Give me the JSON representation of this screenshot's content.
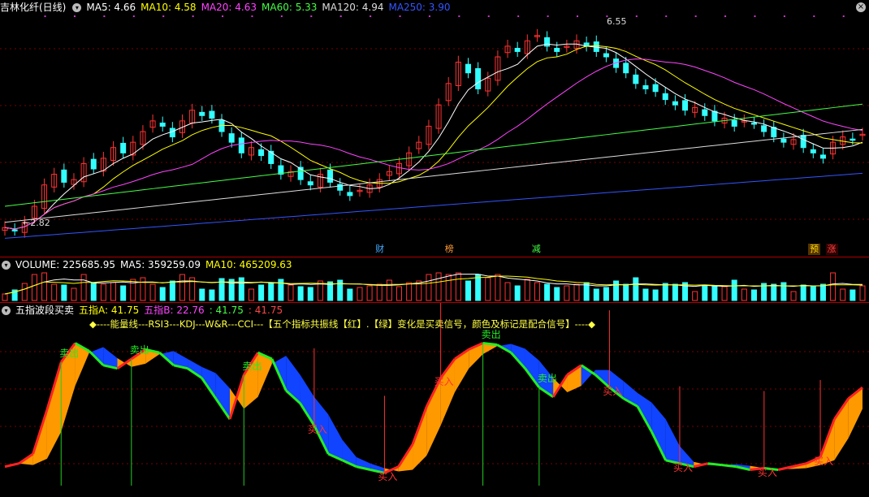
{
  "main": {
    "title": "吉林化纤(日线)",
    "indicators": [
      {
        "label": "MA5: 4.66",
        "color": "#ffffff"
      },
      {
        "label": "MA10: 4.58",
        "color": "#ffff00"
      },
      {
        "label": "MA20: 4.63",
        "color": "#ff44ff"
      },
      {
        "label": "MA60: 5.33",
        "color": "#44ff44"
      },
      {
        "label": "MA120: 4.94",
        "color": "#dddddd"
      },
      {
        "label": "MA250: 3.90",
        "color": "#3355ff"
      }
    ],
    "high_label": "6.55",
    "low_label": "2.82",
    "events": [
      {
        "label": "财",
        "x": 0.43,
        "color": "#44aaff",
        "bg": "#000"
      },
      {
        "label": "榜",
        "x": 0.51,
        "color": "#ff9933",
        "bg": "#000"
      },
      {
        "label": "减",
        "x": 0.61,
        "color": "#44ff44",
        "bg": "#000"
      },
      {
        "label": "预",
        "x": 0.93,
        "color": "#ffdd00",
        "bg": "#553300"
      },
      {
        "label": "涨",
        "x": 0.95,
        "color": "#ff4444",
        "bg": "#330000"
      }
    ]
  },
  "volume": {
    "indicators": [
      {
        "label": "VOLUME: 225685.95",
        "color": "#ffffff"
      },
      {
        "label": "MA5: 359259.09",
        "color": "#ffffff"
      },
      {
        "label": "MA10: 465209.63",
        "color": "#ffff00"
      }
    ]
  },
  "wave": {
    "title": "五指波段买卖",
    "indicators": [
      {
        "label": "五指A: 41.75",
        "color": "#ffff00"
      },
      {
        "label": "五指B: 22.76",
        "color": "#ff44ff"
      },
      {
        "label": ": 41.75",
        "color": "#44ff44"
      },
      {
        "label": ": 41.75",
        "color": "#ff4444"
      }
    ],
    "formula": "◆----能量线---RSI3---KDJ---W&R---CCI---【五个指标共振线【红】.【绿】变化是买卖信号，颜色及标记是配合信号】----◆",
    "sell_label": "卖出",
    "buy_label": "买入"
  },
  "colors": {
    "up": "#ff3333",
    "down": "#33ffff",
    "ma5": "#ffffff",
    "ma10": "#ffff00",
    "ma20": "#ff44ff",
    "ma60": "#44ff44",
    "ma120": "#dddddd",
    "ma250": "#3355ff",
    "fill_up": "#ff9900",
    "fill_down": "#1144ff"
  },
  "chart_data": {
    "type": "candlestick",
    "price_range": [
      2.6,
      6.8
    ],
    "closes": [
      2.9,
      2.85,
      3.0,
      3.3,
      3.7,
      3.9,
      3.75,
      3.8,
      4.1,
      4.0,
      4.2,
      4.4,
      4.3,
      4.5,
      4.7,
      4.9,
      4.8,
      4.6,
      4.9,
      5.1,
      5.0,
      4.95,
      4.7,
      4.5,
      4.3,
      4.4,
      4.25,
      4.1,
      3.9,
      3.95,
      3.8,
      3.7,
      3.9,
      3.75,
      3.6,
      3.5,
      3.6,
      3.7,
      3.8,
      3.95,
      4.1,
      4.3,
      4.5,
      4.8,
      5.2,
      5.6,
      6.0,
      5.8,
      5.5,
      5.7,
      6.1,
      6.3,
      6.2,
      6.4,
      6.5,
      6.3,
      6.2,
      6.3,
      6.4,
      6.3,
      6.2,
      6.1,
      5.9,
      5.8,
      5.6,
      5.5,
      5.45,
      5.3,
      5.2,
      5.1,
      5.15,
      5.0,
      4.9,
      4.95,
      4.8,
      4.9,
      4.85,
      4.7,
      4.6,
      4.5,
      4.55,
      4.4,
      4.3,
      4.2,
      4.5,
      4.6,
      4.55,
      4.65
    ],
    "wave_values": [
      12,
      14,
      20,
      48,
      78,
      90,
      85,
      76,
      74,
      80,
      86,
      84,
      76,
      74,
      68,
      55,
      42,
      70,
      84,
      80,
      60,
      52,
      38,
      20,
      16,
      12,
      10,
      8,
      12,
      26,
      50,
      68,
      80,
      86,
      90,
      89,
      84,
      74,
      62,
      56,
      70,
      76,
      70,
      62,
      55,
      50,
      34,
      16,
      14,
      12,
      14,
      13,
      12,
      10,
      11,
      10,
      12,
      14,
      18,
      42,
      55,
      62
    ]
  }
}
